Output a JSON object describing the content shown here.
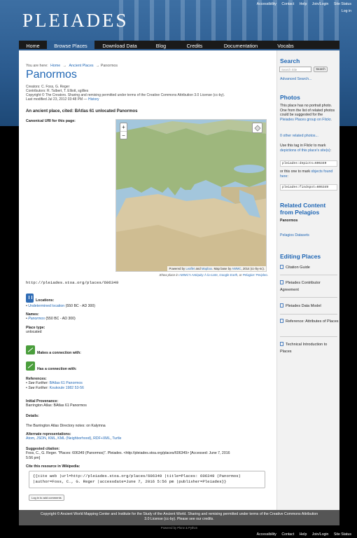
{
  "header": {
    "logo": "PLEIADES",
    "toplinks": [
      "Accessibility",
      "Contact",
      "Help",
      "Join/Login",
      "Site Status"
    ],
    "login": "Log in"
  },
  "nav": {
    "items": [
      "Home",
      "Browse Places",
      "Download Data",
      "Blog",
      "Credits",
      "Documentation",
      "Vocabs"
    ],
    "active": "Browse Places"
  },
  "breadcrumb": {
    "prefix": "You are here:",
    "home": "Home",
    "sep": "→",
    "section": "Ancient Places",
    "current": "Panormos"
  },
  "place": {
    "title": "Panormos",
    "creators": "Creators: C. Foss, G. Reger",
    "contributors": "Contributors: R. Talbert, T. Elliott, sgillies",
    "copyright": "Copyright © The Creators. Sharing and remixing permitted under terms of the Creative Commons Attribution 3.0 License (cc-by).",
    "modified_prefix": "Last modified Jul 23, 2012 03:48 PM —",
    "history": "History",
    "description": "An ancient place, cited: BAtlas 61 unlocated Panormos",
    "canonical_label": "Canonical URI for this page:",
    "uri": "http://pleiades.stoa.org/places/606349"
  },
  "map": {
    "zoom_in": "+",
    "zoom_out": "−",
    "attrib_pre": "Powered by",
    "attrib_leaflet": "Leaflet",
    "attrib_and": "and",
    "attrib_mapbox": "Mapbox",
    "attrib_mid": ". Map base by",
    "attrib_awmc": "AWMC",
    "attrib_post": ", 2014 (cc-by-nc).",
    "show_prefix": "Show place in",
    "show_awmc": "AWMC's Antiquity À-la-carte",
    "show_comma": ",",
    "show_google": "Google Earth",
    "show_or": ", or",
    "show_pelagios": "Pelagios' Peripleo",
    "show_end": "."
  },
  "locations": {
    "label": "Locations:",
    "link": "Undetermined location",
    "range": "(550 BC - AD 300)"
  },
  "names": {
    "label": "Names:",
    "link": "Panormos",
    "range": "(550 BC - AD 300)"
  },
  "place_type": {
    "label": "Place type:",
    "value": "unlocated"
  },
  "connections": {
    "makes": "Makes a connection with:",
    "has": "Has a connection with:"
  },
  "references": {
    "label": "References:",
    "items": [
      {
        "prefix": "See Further:",
        "link": "BAtlas 61 Panormos"
      },
      {
        "prefix": "See Further:",
        "link": "Koukoule 1982 53-56"
      }
    ]
  },
  "provenance": {
    "label": "Initial Provenance:",
    "value": "Barrington Atlas: BAtlas 61 Panormos"
  },
  "details": {
    "label": "Details:",
    "text": "The Barrington Atlas Directory notes: on Kalymna"
  },
  "alternate": {
    "label": "Alternate representations:",
    "links": [
      "Atom",
      "JSON",
      "KML",
      "KML (Neighborhood)",
      "RDF+XML",
      "Turtle"
    ]
  },
  "citation": {
    "label": "Suggested citation:",
    "text1": "Foss, C., G. Reger. \"Places: 606349 (Panormos)\". Pleiades. <http://pleiades.stoa.org/places/606349> [Accessed: June 7, 2016",
    "text2": "5:56 pm]"
  },
  "wikipedia": {
    "label": "Cite this resource in Wikipedia:",
    "line1": "{{cite web |url=http://pleiades.stoa.org/places/606349 |title=Places: 606349 (Panormos)",
    "line2": "|author=Foss, C., G. Reger |accessdate=June 7, 2016 5:56 pm |publisher=Pleiades}}"
  },
  "login_comments": "Log in to add comments",
  "sidebar": {
    "search_heading": "Search",
    "search_placeholder": "Search Site",
    "search_button": "Search",
    "advanced": "Advanced Search...",
    "photos_heading": "Photos",
    "photos_text1": "This place has no portrait photo. One from the list of related photos could be suggested for the",
    "photos_link": "Pleiades Places group on Flickr",
    "photos_related": "0 other related photos...",
    "tag_text1": "Use this tag in Flickr to mark",
    "tag_link": "depictions of this place's site(s)",
    "tag_code": "pleiades:depicts=606349",
    "or_text": "or this one to mark",
    "or_link": "objects found here",
    "findspot_code": "pleiades:findspot=606349",
    "related_heading": "Related Content from Pelagios",
    "related_place": "Panormos",
    "pelagios_link": "Pelagios Datasets",
    "editing_heading": "Editing Places",
    "editing_items": [
      "Citation Guide",
      "Pleiades Contributor Agreement",
      "Pleiades Data Model",
      "Reference: Attributes of Places",
      "Technical Introduction to Places"
    ]
  },
  "footer": {
    "line1": "Copyright © Ancient World Mapping Center and Institute for the Study of the Ancient World. Sharing and remixing permitted under terms of the Creative Commons Attribution",
    "line2": "3.0 License (cc-by). Please see our credits.",
    "powered": "Powered by Plone & Python"
  }
}
